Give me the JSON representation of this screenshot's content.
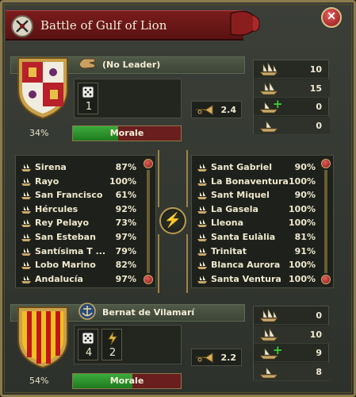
{
  "title": "Battle of Gulf of Lion",
  "close_icon": "close-icon",
  "colors": {
    "title_red": "#7a1c1c",
    "morale_green": "#2f962f",
    "morale_red": "#6a1e1e",
    "gold": "#9c8446"
  },
  "attacker": {
    "leader_name": "(No Leader)",
    "dice": [
      "1"
    ],
    "discipline": "2.4",
    "morale_pct": "34%",
    "morale_label": "Morale",
    "morale_level": 0.42,
    "ships": [
      {
        "icon": "heavy-ship-icon",
        "count": "10"
      },
      {
        "icon": "light-ship-icon",
        "count": "15"
      },
      {
        "icon": "galley-reinforce-icon",
        "count": "0"
      },
      {
        "icon": "transport-icon",
        "count": "0"
      }
    ],
    "units": [
      {
        "name": "Sirena",
        "strength": "87%"
      },
      {
        "name": "Rayo",
        "strength": "100%"
      },
      {
        "name": "San Francisco",
        "strength": "61%"
      },
      {
        "name": "Hércules",
        "strength": "92%"
      },
      {
        "name": "Rey Pelayo",
        "strength": "73%"
      },
      {
        "name": "San Esteban",
        "strength": "97%"
      },
      {
        "name": "Santísima T ...",
        "strength": "79%"
      },
      {
        "name": "Lobo Marino",
        "strength": "82%"
      },
      {
        "name": "Andalucía",
        "strength": "97%"
      }
    ]
  },
  "defender": {
    "leader_name": "Bernat de Vilamarí",
    "dice": [
      "4",
      "2"
    ],
    "discipline": "2.2",
    "morale_pct": "54%",
    "morale_label": "Morale",
    "morale_level": 0.55,
    "ships": [
      {
        "icon": "heavy-ship-icon",
        "count": "0"
      },
      {
        "icon": "light-ship-icon",
        "count": "10"
      },
      {
        "icon": "galley-reinforce-icon",
        "count": "9"
      },
      {
        "icon": "transport-icon",
        "count": "8"
      }
    ],
    "units": [
      {
        "name": "Sant Gabriel",
        "strength": "90%"
      },
      {
        "name": "La Bonaventura",
        "strength": "100%"
      },
      {
        "name": "Sant Miquel",
        "strength": "90%"
      },
      {
        "name": "La Gasela",
        "strength": "100%"
      },
      {
        "name": "Lleona",
        "strength": "100%"
      },
      {
        "name": "Santa Eulàlia",
        "strength": "81%"
      },
      {
        "name": "Trinitat",
        "strength": "91%"
      },
      {
        "name": "Blanca Aurora",
        "strength": "100%"
      },
      {
        "name": "Santa Ventura",
        "strength": "100%"
      }
    ]
  }
}
